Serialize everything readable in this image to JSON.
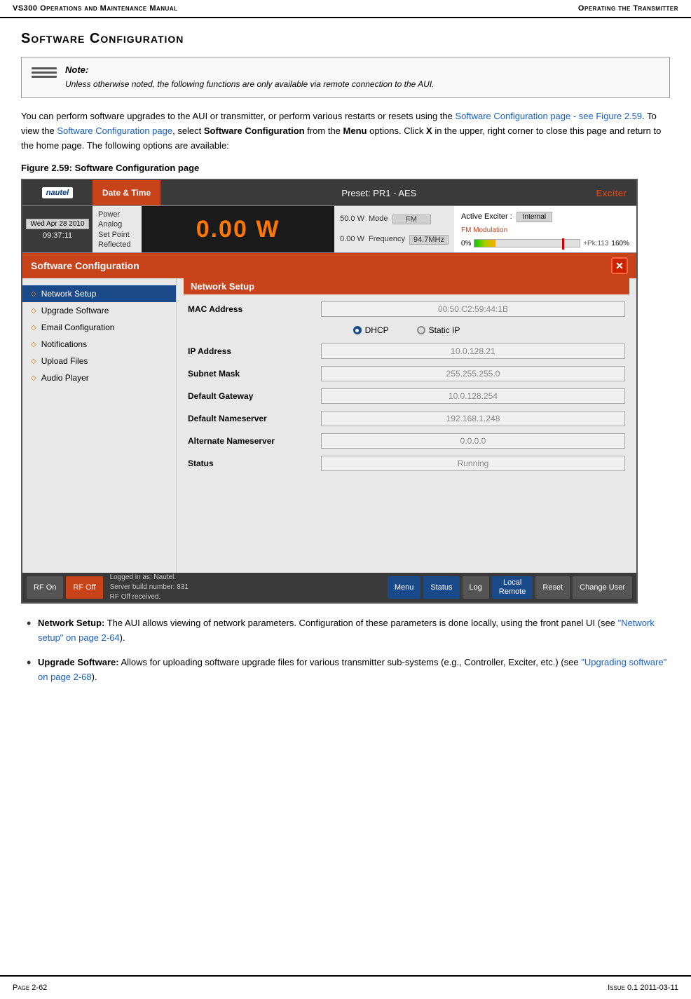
{
  "header": {
    "left": "VS300 Operations and Maintenance Manual",
    "right": "Operating the Transmitter"
  },
  "section_title": "Software Configuration",
  "note": {
    "label": "Note:",
    "text": "Unless otherwise noted, the following functions are only available via remote connection to the AUI."
  },
  "body_paragraphs": [
    "You can perform software upgrades to the AUI or transmitter, or perform various restarts or resets using the Software Configuration page - see Figure 2.59. To view the Software Configuration page, select Software Configuration from the Menu options. Click X in the upper, right corner to close this page and return to the home page. The following options are available:"
  ],
  "figure_caption": "Figure 2.59: Software Configuration page",
  "tx_ui": {
    "topbar": {
      "date_tab": "Date & Time",
      "preset": "Preset: PR1 - AES",
      "exciter_label": "Exciter"
    },
    "midbar": {
      "date": "Wed Apr 28 2010",
      "time": "09:37:11",
      "power_labels": [
        "Power",
        "Analog",
        "Set Point",
        "Reflected"
      ],
      "power_value": "0.00 W",
      "set_point": "50.0 W",
      "reflected": "0.00 W",
      "mode_label": "Mode",
      "mode_value": "FM",
      "freq_label": "Frequency",
      "freq_value": "94.7MHz",
      "active_exciter_label": "Active Exciter :",
      "active_exciter_value": "Internal",
      "fm_label": "FM Modulation",
      "fm_pct_left": "0%",
      "fm_pct_right": "160%",
      "fm_marker": "+Pk:113"
    },
    "sw_config": {
      "header": "Software Configuration",
      "sidebar_items": [
        {
          "label": "Network Setup",
          "active": true
        },
        {
          "label": "Upgrade Software",
          "active": false
        },
        {
          "label": "Email Configuration",
          "active": false
        },
        {
          "label": "Notifications",
          "active": false
        },
        {
          "label": "Upload Files",
          "active": false
        },
        {
          "label": "Audio Player",
          "active": false
        }
      ],
      "content_header": "Network Setup",
      "fields": [
        {
          "label": "MAC Address",
          "value": "00:50:C2:59:44:1B"
        },
        {
          "label": "IP Address",
          "value": "10.0.128.21"
        },
        {
          "label": "Subnet Mask",
          "value": "255.255.255.0"
        },
        {
          "label": "Default Gateway",
          "value": "10.0.128.254"
        },
        {
          "label": "Default Nameserver",
          "value": "192.168.1.248"
        },
        {
          "label": "Alternate Nameserver",
          "value": "0.0.0.0"
        },
        {
          "label": "Status",
          "value": "Running"
        }
      ],
      "radio_options": [
        {
          "label": "DHCP",
          "selected": true
        },
        {
          "label": "Static IP",
          "selected": false
        }
      ]
    },
    "bottombar": {
      "rf_on": "RF On",
      "rf_off": "RF Off",
      "logged_in_line1": "Logged in as:    Nautel.",
      "logged_in_line2": "Server build number: 831",
      "logged_in_line3": "RF Off received.",
      "menu": "Menu",
      "status": "Status",
      "log": "Log",
      "local_remote_line1": "Local",
      "local_remote_line2": "Remote",
      "reset": "Reset",
      "change_user": "Change User"
    }
  },
  "bullets": [
    {
      "term": "Network Setup:",
      "text": "The AUI allows viewing of network parameters. Configuration of these parameters is done locally, using the front panel UI (see “Network setup” on page 2-64)."
    },
    {
      "term": "Upgrade Software:",
      "text": "Allows for uploading software upgrade files for various transmitter sub-systems (e.g., Controller, Exciter, etc.) (see “Upgrading software” on page 2-68)."
    }
  ],
  "footer": {
    "left": "Page 2-62",
    "right": "Issue 0.1  2011-03-11"
  }
}
